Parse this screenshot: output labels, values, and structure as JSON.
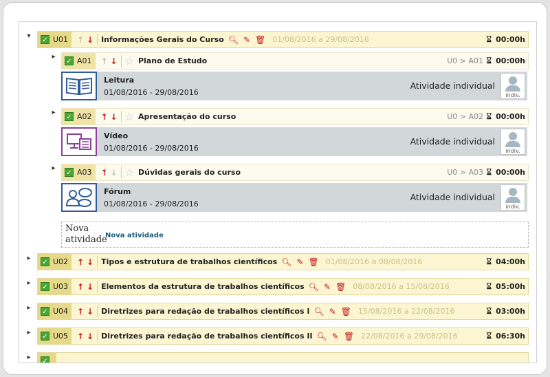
{
  "units": [
    {
      "code": "U01",
      "title": "Informações Gerais do Curso",
      "dates": "01/08/2016 a 29/08/2016",
      "hours": "00:00h",
      "up_active": false,
      "down_active": true,
      "expanded": true
    },
    {
      "code": "U02",
      "title": "Tipos e estrutura de trabalhos científicos",
      "dates": "01/08/2016 a 08/08/2016",
      "hours": "04:00h",
      "up_active": true,
      "down_active": true
    },
    {
      "code": "U03",
      "title": "Elementos da estrutura de trabalhos científicos",
      "dates": "08/08/2016 a 15/08/2016",
      "hours": "05:00h",
      "up_active": true,
      "down_active": true
    },
    {
      "code": "U04",
      "title": "Diretrizes para redação de trabalhos científicos I",
      "dates": "15/08/2016 a 22/08/2016",
      "hours": "03:00h",
      "up_active": true,
      "down_active": true
    },
    {
      "code": "U05",
      "title": "Diretrizes para redação de trabalhos científicos II",
      "dates": "22/08/2016 a 29/08/2016",
      "hours": "06:30h",
      "up_active": true,
      "down_active": true
    }
  ],
  "activities": [
    {
      "code": "A01",
      "title": "Plano de Estudo",
      "path": "U0 > A01",
      "hours": "00:00h",
      "name": "Leitura",
      "dates": "01/08/2016 - 29/08/2016",
      "kind": "Atividade individual",
      "avatar_label": "indiv.",
      "icon": "book-icon",
      "icon_color": "#2e5c99"
    },
    {
      "code": "A02",
      "title": "Apresentação do curso",
      "path": "U0 > A02",
      "hours": "00:00h",
      "name": "Vídeo",
      "dates": "01/08/2016 - 29/08/2016",
      "kind": "Atividade individual",
      "avatar_label": "indiv.",
      "icon": "video-icon",
      "icon_color": "#8e3f9c"
    },
    {
      "code": "A03",
      "title": "Dúvidas gerais do curso",
      "path": "U0 > A03",
      "hours": "00:00h",
      "name": "Fórum",
      "dates": "01/08/2016 - 29/08/2016",
      "kind": "Atividade individual",
      "avatar_label": "indiv.",
      "icon": "forum-icon",
      "icon_color": "#2e5c99"
    }
  ],
  "new_activity": {
    "image_alt": "Nova atividade",
    "link": "Nova atividade"
  },
  "glyphs": {
    "check": "✓",
    "up": "↑",
    "down": "↓",
    "star": "☆",
    "search": "🔍︎",
    "edit": "✎",
    "trash": "🗑︎",
    "hourglass": "⌛︎",
    "expand_open": "▾",
    "expand_closed": "▸"
  },
  "colors": {
    "unit_bg": "#fbf6d1",
    "code_bg": "#e6d98a",
    "arrow_active": "#c0181b",
    "arrow_inactive": "#bdbdbd",
    "detail_bg": "#d2d7d9",
    "check_green": "#4aa634"
  }
}
